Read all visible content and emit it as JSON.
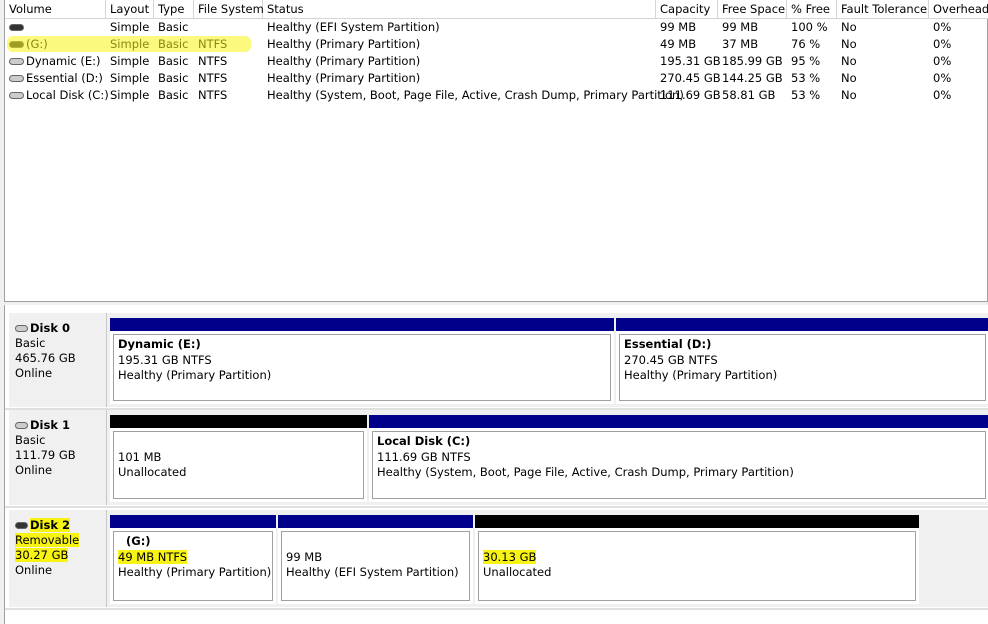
{
  "columns": [
    "Volume",
    "Layout",
    "Type",
    "File System",
    "Status",
    "Capacity",
    "Free Space",
    "% Free",
    "Fault Tolerance",
    "Overhead"
  ],
  "volumes": [
    {
      "icon": "removable-drive-icon",
      "volume": "",
      "layout": "Simple",
      "type": "Basic",
      "fs": "",
      "status": "Healthy (EFI System Partition)",
      "capacity": "99 MB",
      "free": "99 MB",
      "pct": "100 %",
      "fault": "No",
      "overhead": "0%"
    },
    {
      "icon": "removable-drive-icon",
      "volume": "(G:)",
      "layout": "Simple",
      "type": "Basic",
      "fs": "NTFS",
      "status": "Healthy (Primary Partition)",
      "capacity": "49 MB",
      "free": "37 MB",
      "pct": "76 %",
      "fault": "No",
      "overhead": "0%"
    },
    {
      "icon": "disk-drive-icon",
      "volume": "Dynamic (E:)",
      "layout": "Simple",
      "type": "Basic",
      "fs": "NTFS",
      "status": "Healthy (Primary Partition)",
      "capacity": "195.31 GB",
      "free": "185.99 GB",
      "pct": "95 %",
      "fault": "No",
      "overhead": "0%"
    },
    {
      "icon": "disk-drive-icon",
      "volume": "Essential (D:)",
      "layout": "Simple",
      "type": "Basic",
      "fs": "NTFS",
      "status": "Healthy (Primary Partition)",
      "capacity": "270.45 GB",
      "free": "144.25 GB",
      "pct": "53 %",
      "fault": "No",
      "overhead": "0%"
    },
    {
      "icon": "disk-drive-icon",
      "volume": "Local Disk (C:)",
      "layout": "Simple",
      "type": "Basic",
      "fs": "NTFS",
      "status": "Healthy (System, Boot, Page File, Active, Crash Dump, Primary Partition)",
      "capacity": "111.69 GB",
      "free": "58.81 GB",
      "pct": "53 %",
      "fault": "No",
      "overhead": "0%"
    }
  ],
  "disks": [
    {
      "name": "Disk 0",
      "type": "Basic",
      "size": "465.76 GB",
      "state": "Online",
      "partitions": [
        {
          "title": "Dynamic  (E:)",
          "size": "195.31 GB NTFS",
          "status": "Healthy (Primary Partition)"
        },
        {
          "title": "Essential  (D:)",
          "size": "270.45 GB NTFS",
          "status": "Healthy (Primary Partition)"
        }
      ]
    },
    {
      "name": "Disk 1",
      "type": "Basic",
      "size": "111.79 GB",
      "state": "Online",
      "partitions": [
        {
          "title": "",
          "size": "101 MB",
          "status": "Unallocated"
        },
        {
          "title": "Local Disk  (C:)",
          "size": "111.69 GB NTFS",
          "status": "Healthy (System, Boot, Page File, Active, Crash Dump, Primary Partition)"
        }
      ]
    },
    {
      "name": "Disk 2",
      "type": "Removable",
      "size": "30.27 GB",
      "state": "Online",
      "partitions": [
        {
          "title": "(G:)",
          "size": "49 MB NTFS",
          "status": "Healthy (Primary Partition)"
        },
        {
          "title": "",
          "size": "99 MB",
          "status": "Healthy (EFI System Partition)"
        },
        {
          "title": "",
          "size": "30.13 GB",
          "status": "Unallocated"
        }
      ]
    }
  ],
  "colors": {
    "primary": "#00008b",
    "unallocated": "#000000",
    "highlight": "#f7f414"
  }
}
